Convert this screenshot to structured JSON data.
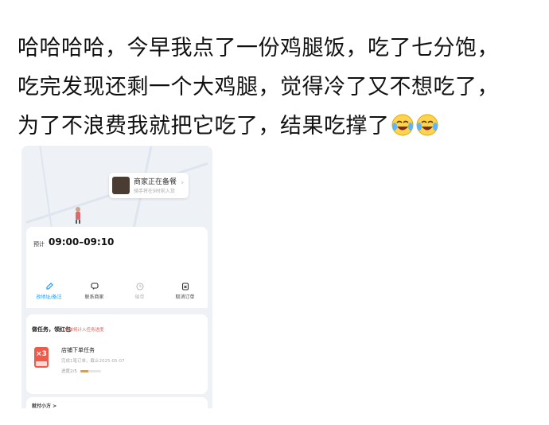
{
  "post": {
    "lines": [
      "哈哈哈哈，今早我点了一份鸡腿饭，吃了七分饱，",
      "吃完发现还剩一个大鸡腿，觉得冷了又不想吃了，",
      "为了不浪费我就把它吃了，结果吃撑了"
    ],
    "emoji": [
      "laughing-crying-emoji",
      "laughing-crying-emoji"
    ]
  },
  "order": {
    "status_title": "商家正在备餐",
    "status_subtitle": "骑手将在9时前入货",
    "eta_label": "预计",
    "eta_time": "09:00–09:10",
    "actions": [
      {
        "label": "改地址/备注",
        "icon": "edit-icon",
        "color": "#1a9cff"
      },
      {
        "label": "联系商家",
        "icon": "chat-icon",
        "color": "#333333"
      },
      {
        "label": "催单",
        "icon": "clock-icon",
        "color": "#bbbbbb"
      },
      {
        "label": "取消订单",
        "icon": "cancel-icon",
        "color": "#333333"
      }
    ],
    "task": {
      "title": "做任务，领红包",
      "hint": "本单将计入任务进度",
      "badge": "×3",
      "name": "店铺下单任务",
      "meta": "完成1笔订单，截止2025-05-07",
      "progress_label": "进度2/5",
      "progress": 0.4,
      "accent": "#ef5b4b"
    },
    "footer_label": "就付小方 >"
  }
}
